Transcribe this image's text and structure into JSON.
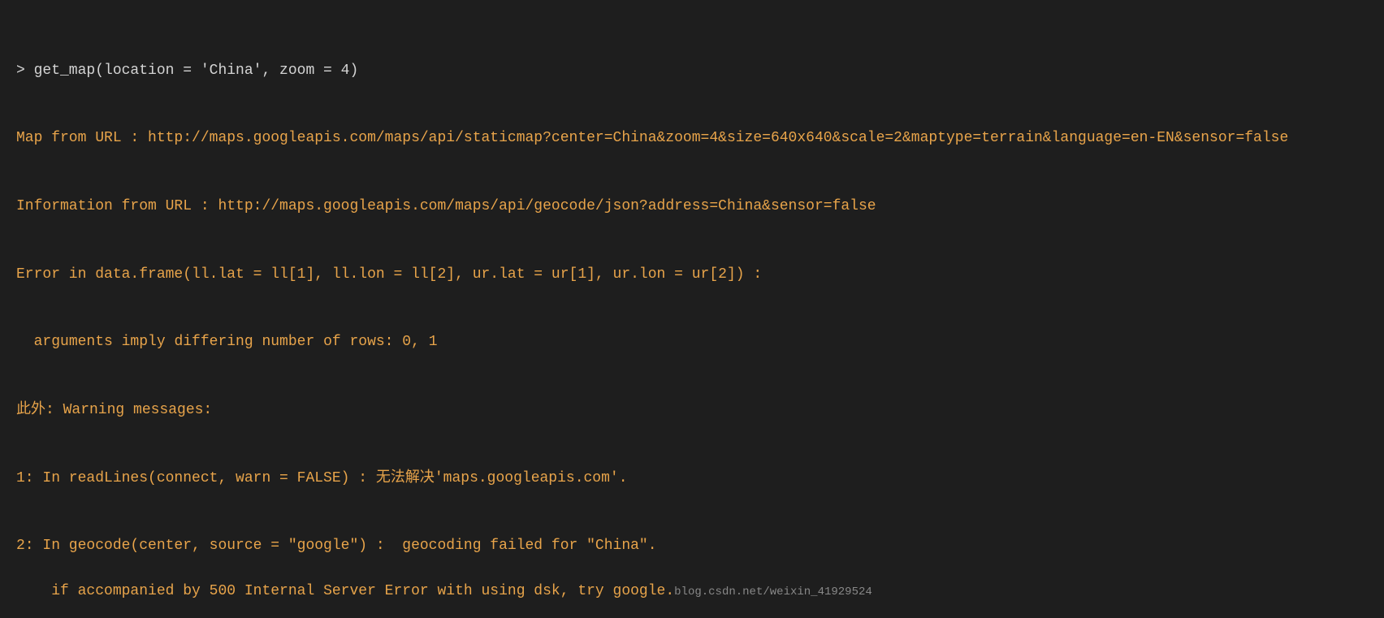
{
  "console": {
    "lines": [
      {
        "id": "cmd",
        "type": "command",
        "text": "> get_map(location = 'China', zoom = 4)"
      },
      {
        "id": "map-url",
        "type": "orange",
        "text": "Map from URL : http://maps.googleapis.com/maps/api/staticmap?center=China&zoom=4&size=640x640&scale=2&maptype=terrain&language=en-EN&sensor=false"
      },
      {
        "id": "info-url",
        "type": "orange",
        "text": "Information from URL : http://maps.googleapis.com/maps/api/geocode/json?address=China&sensor=false"
      },
      {
        "id": "error-line1",
        "type": "orange",
        "text": "Error in data.frame(ll.lat = ll[1], ll.lon = ll[2], ur.lat = ur[1], ur.lon = ur[2]) :"
      },
      {
        "id": "error-line2",
        "type": "orange",
        "text": "  arguments imply differing number of rows: 0, 1"
      },
      {
        "id": "warning-header",
        "type": "orange",
        "text": "此外: Warning messages:"
      },
      {
        "id": "warn1",
        "type": "orange",
        "text": "1: In readLines(connect, warn = FALSE) : 无法解决'maps.googleapis.com'."
      },
      {
        "id": "warn2-line1",
        "type": "orange",
        "text": "2: In geocode(center, source = \"google\") :  geocoding failed for \"China\"."
      },
      {
        "id": "warn2-line2",
        "type": "orange",
        "text": "  if accompanied by 500 Internal Server Error with using dsk, try google."
      }
    ],
    "watermark": "blog.csdn.net/weixin_41929524"
  }
}
